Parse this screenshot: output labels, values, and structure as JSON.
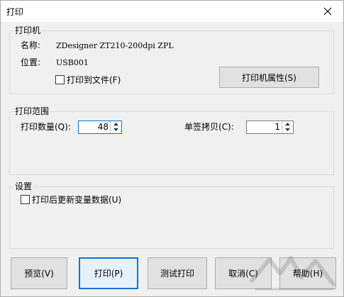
{
  "window": {
    "title": "打印"
  },
  "printer_group": {
    "label": "打印机",
    "name_label": "名称:",
    "name_value": "ZDesigner ZT210-200dpi ZPL",
    "location_label": "位置:",
    "location_value": "USB001",
    "print_to_file_label": "打印到文件(F)",
    "print_to_file_checked": false,
    "properties_button": "打印机属性(S)"
  },
  "range_group": {
    "label": "打印范围",
    "quantity_label": "打印数量(Q):",
    "quantity_value": "48",
    "copies_label": "单签拷贝(C):",
    "copies_value": "1"
  },
  "settings_group": {
    "label": "设置",
    "update_vars_label": "打印后更新变量数据(U)",
    "update_vars_checked": false
  },
  "buttons": {
    "preview": "预览(V)",
    "print": "打印(P)",
    "test_print": "测试打印",
    "cancel": "取消(C)",
    "help": "帮助(H)"
  },
  "icons": {
    "close": "close-icon",
    "spin_up": "arrow-up-icon",
    "spin_down": "arrow-down-icon"
  }
}
